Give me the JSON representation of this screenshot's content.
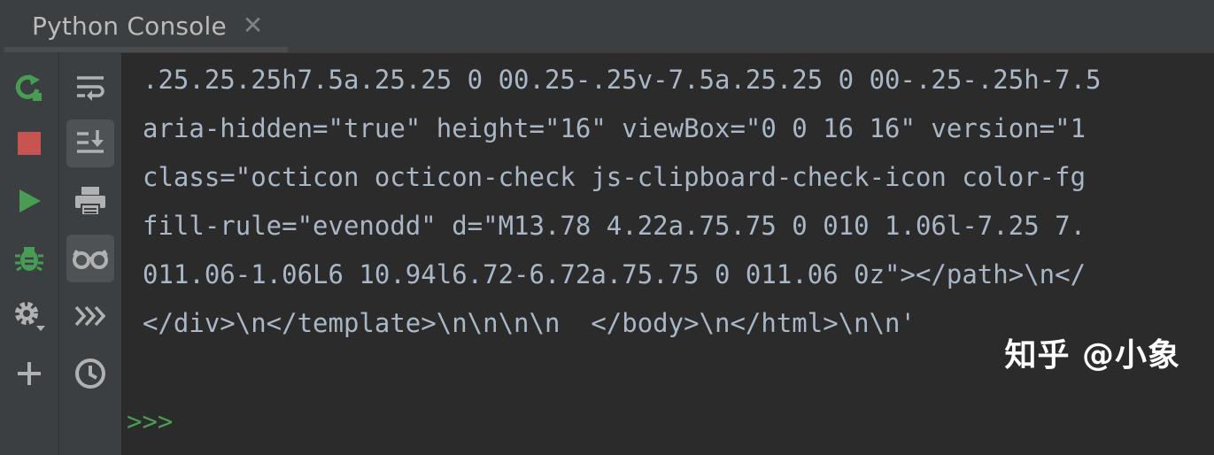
{
  "tab": {
    "title": "Python Console",
    "close_icon": "close-icon"
  },
  "left_toolbar": [
    {
      "icon": "rerun-icon",
      "color": "#499c54"
    },
    {
      "icon": "stop-icon",
      "color": "#c75450"
    },
    {
      "icon": "run-icon",
      "color": "#499c54"
    },
    {
      "icon": "debug-icon",
      "color": "#499c54"
    },
    {
      "icon": "settings-icon",
      "color": "#afb1b3"
    },
    {
      "icon": "add-icon",
      "color": "#afb1b3"
    }
  ],
  "right_toolbar": [
    {
      "icon": "soft-wrap-icon"
    },
    {
      "icon": "scroll-to-end-icon",
      "active": true
    },
    {
      "icon": "print-icon"
    },
    {
      "icon": "show-variables-icon",
      "active": true
    },
    {
      "icon": "execute-next-icon"
    },
    {
      "icon": "history-icon"
    }
  ],
  "console": {
    "lines": [
      ".25.25.25h7.5a.25.25 0 00.25-.25v-7.5a.25.25 0 00-.25-.25h-7.5",
      "aria-hidden=\"true\" height=\"16\" viewBox=\"0 0 16 16\" version=\"1",
      "class=\"octicon octicon-check js-clipboard-check-icon color-fg",
      "fill-rule=\"evenodd\" d=\"M13.78 4.22a.75.75 0 010 1.06l-7.25 7.",
      "011.06-1.06L6 10.94l6.72-6.72a.75.75 0 011.06 0z\"></path>\\n</",
      "</div>\\n</template>\\n\\n\\n\\n  </body>\\n</html>\\n\\n'"
    ],
    "prompt": ">>>"
  },
  "watermark": "知乎 @小象",
  "colors": {
    "background": "#2b2b2b",
    "toolbar": "#3c3f41",
    "text": "#a9b7c6",
    "prompt": "#499c54"
  }
}
